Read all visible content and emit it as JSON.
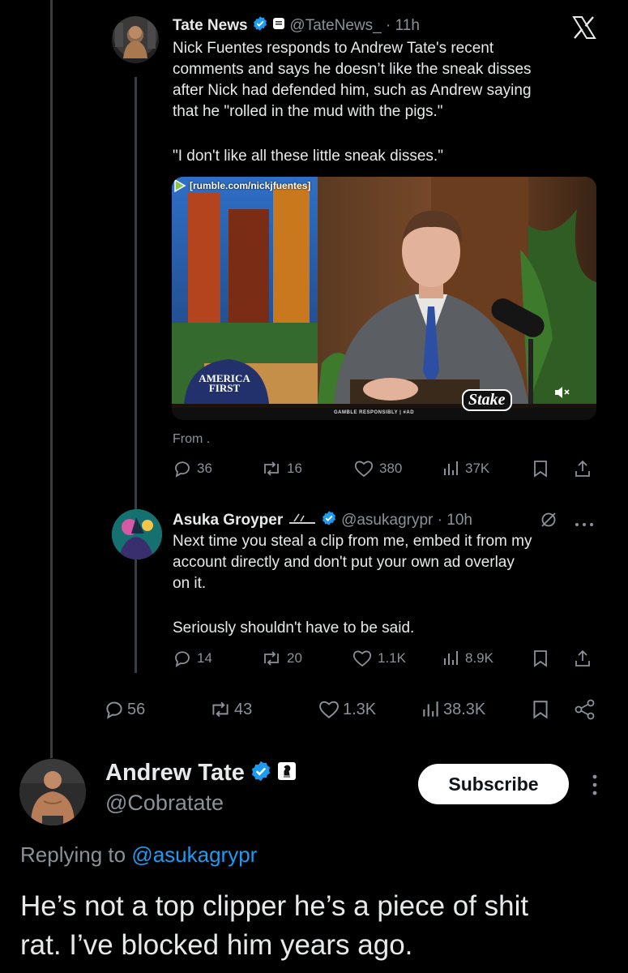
{
  "quoted_tweet": {
    "author_name": "Tate News",
    "handle": "@TateNews_",
    "time": "11h",
    "text_lines": [
      "Nick Fuentes responds to Andrew Tate's recent",
      "comments and says he doesn’t like the sneak disses",
      "after Nick had defended him, such as Andrew saying",
      "that he \"rolled in the mud with the pigs.\""
    ],
    "quote_line": "\"I don't like all these little sneak disses.\"",
    "video": {
      "overlay_url": "[rumble.com/nickjfuentes]",
      "hat_text_line1": "AMERICA",
      "hat_text_line2": "FIRST",
      "sponsor": "Stake",
      "disclaimer": "GAMBLE RESPONSIBLY | #AD"
    },
    "from_label": "From .",
    "stats": {
      "replies": "36",
      "reposts": "16",
      "likes": "380",
      "views": "37K"
    }
  },
  "reply_tweet": {
    "author_name": "Asuka Groyper",
    "handle": "@asukagrypr",
    "time": "10h",
    "text_lines": [
      "Next time you steal a clip from me, embed it from my",
      "account directly and don't put your own ad overlay",
      "on it."
    ],
    "second_line": "Seriously shouldn't have to be said.",
    "stats": {
      "replies": "14",
      "reposts": "20",
      "likes": "1.1K",
      "views": "8.9K"
    }
  },
  "parent_stats": {
    "replies": "56",
    "reposts": "43",
    "likes": "1.3K",
    "views": "38.3K"
  },
  "main_tweet": {
    "author_name": "Andrew Tate",
    "handle": "@Cobratate",
    "subscribe_label": "Subscribe",
    "replying_prefix": "Replying to",
    "replying_handle": "@asukagrypr",
    "text_lines": [
      "He’s not a top clipper he’s a piece of shit",
      "rat. I’ve blocked him years ago."
    ]
  },
  "colors": {
    "accent": "#1d9bf0",
    "muted": "#8b9198",
    "text": "#e7e9ea",
    "background": "#000000"
  },
  "icons": [
    "x-logo",
    "verified-icon",
    "reply-icon",
    "repost-icon",
    "like-icon",
    "views-icon",
    "bookmark-icon",
    "share-icon",
    "more-icon",
    "grok-icon"
  ]
}
